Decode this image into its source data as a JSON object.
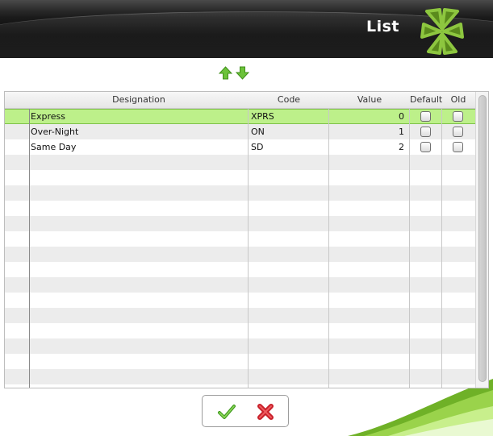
{
  "header": {
    "title": "List"
  },
  "toolbar": {
    "move_up_icon": "arrow-up-icon",
    "move_down_icon": "arrow-down-icon"
  },
  "table": {
    "columns": [
      "Designation",
      "Code",
      "Value",
      "Default",
      "Old"
    ],
    "rows": [
      {
        "designation": "Express",
        "code": "XPRS",
        "value": "0",
        "default": false,
        "old": false,
        "selected": true
      },
      {
        "designation": "Over-Night",
        "code": "ON",
        "value": "1",
        "default": false,
        "old": false,
        "selected": false
      },
      {
        "designation": "Same Day",
        "code": "SD",
        "value": "2",
        "default": false,
        "old": false,
        "selected": false
      }
    ],
    "selected_row_color": "#bdf08a"
  },
  "actions": {
    "confirm_icon": "checkmark-icon",
    "cancel_icon": "red-x-icon"
  },
  "colors": {
    "header_bg": "#111111",
    "accent_green": "#8dc63f",
    "selection": "#bdf08a"
  }
}
